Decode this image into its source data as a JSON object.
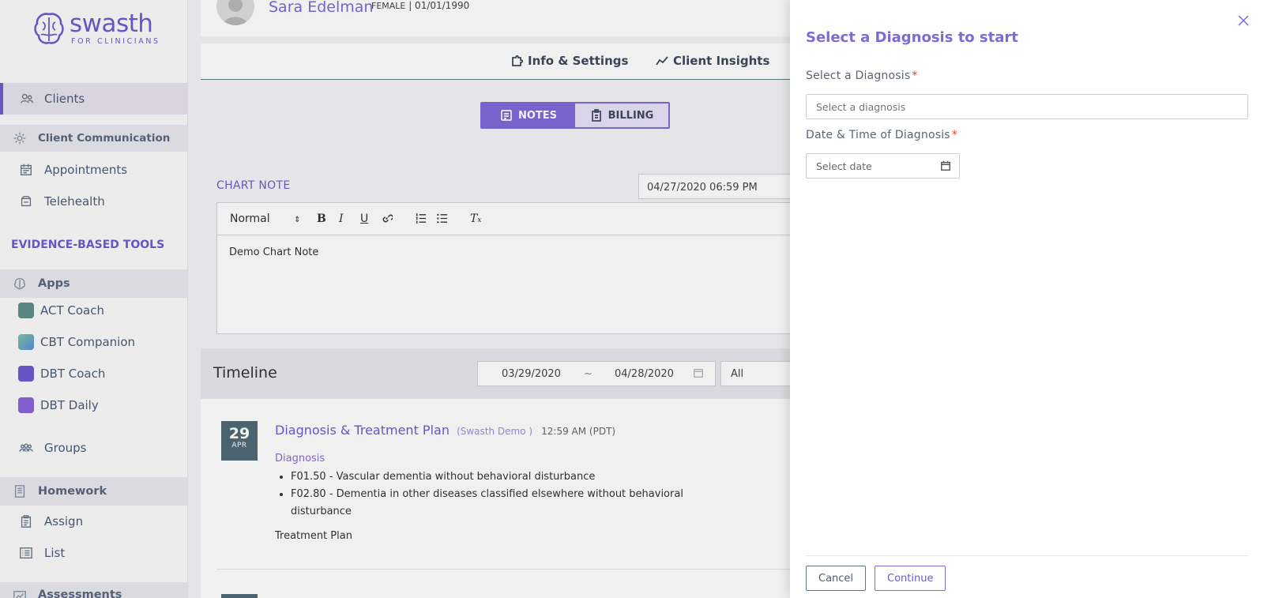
{
  "logo": {
    "name": "swasth",
    "sub": "FOR CLINICIANS"
  },
  "sidebar": {
    "clients": "Clients",
    "client_communication": "Client Communication",
    "appointments": "Appointments",
    "telehealth": "Telehealth",
    "tools_title": "EVIDENCE-BASED TOOLS",
    "apps": "Apps",
    "app_items": [
      "ACT Coach",
      "CBT Companion",
      "DBT Coach",
      "DBT Daily"
    ],
    "groups": "Groups",
    "homework": "Homework",
    "assign": "Assign",
    "list": "List",
    "assessments": "Assessments"
  },
  "client": {
    "name": "Sara Edelman",
    "gender": "FEMALE",
    "dob": "| 01/01/1990"
  },
  "tabs": {
    "info": "Info & Settings",
    "insights": "Client Insights"
  },
  "segment": {
    "notes": "NOTES",
    "billing": "BILLING"
  },
  "chart_note": {
    "label": "CHART NOTE",
    "datetime": "04/27/2020 06:59 PM",
    "format": "Normal",
    "body": "Demo Chart Note"
  },
  "timeline": {
    "title": "Timeline",
    "from": "03/29/2020",
    "sep": "~",
    "to": "04/28/2020",
    "filter": "All"
  },
  "entry": {
    "day": "29",
    "month": "APR",
    "title": "Diagnosis & Treatment Plan",
    "author": "(Swasth Demo )",
    "time": "12:59 AM (PDT)",
    "diag_label": "Diagnosis",
    "diagnoses": [
      "F01.50 - Vascular dementia without behavioral disturbance",
      "F02.80 - Dementia in other diseases classified elsewhere without behavioral disturbance"
    ],
    "treatment": "Treatment Plan"
  },
  "drawer": {
    "title": "Select a Diagnosis to start",
    "diag_label": "Select a Diagnosis",
    "diag_placeholder": "Select a diagnosis",
    "date_label": "Date & Time of Diagnosis",
    "date_placeholder": "Select date",
    "required_mark": "*",
    "cancel": "Cancel",
    "continue": "Continue"
  },
  "colors": {
    "accent": "#6d5bd0",
    "badge": "#4f6a75",
    "required": "#e03a3a"
  }
}
